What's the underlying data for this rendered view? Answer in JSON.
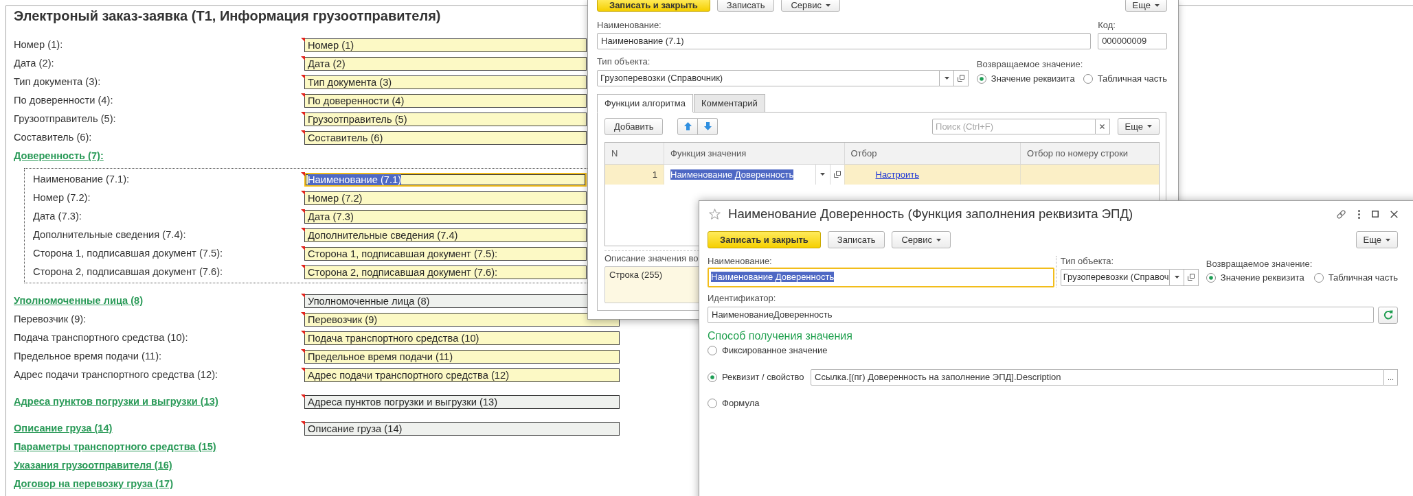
{
  "main_form": {
    "title": "Электроный заказ-заявка (Т1, Информация грузоотправителя)",
    "rows": [
      {
        "kind": "field",
        "label": "Номер (1):",
        "value": "Номер (1)"
      },
      {
        "kind": "field",
        "label": "Дата (2):",
        "value": "Дата (2)"
      },
      {
        "kind": "field",
        "label": "Тип документа (3):",
        "value": "Тип документа (3)"
      },
      {
        "kind": "field",
        "label": "По доверенности (4):",
        "value": "По доверенности (4)"
      },
      {
        "kind": "field",
        "label": "Грузоотправитель (5):",
        "value": "Грузоотправитель (5)"
      },
      {
        "kind": "field",
        "label": "Составитель (6):",
        "value": "Составитель (6)"
      },
      {
        "kind": "group",
        "label": "Доверенность (7):",
        "fields": [
          {
            "label": "Наименование (7.1):",
            "value": "Наименование (7.1)",
            "focused": true
          },
          {
            "label": "Номер (7.2):",
            "value": "Номер (7.2)",
            "focused": false
          },
          {
            "label": "Дата (7.3):",
            "value": "Дата (7.3)",
            "focused": false
          },
          {
            "label": "Дополнительные сведения (7.4):",
            "value": "Дополнительные сведения (7.4)",
            "focused": false
          },
          {
            "label": "Сторона 1, подписавшая документ (7.5):",
            "value": "Сторона 1, подписавшая документ (7.5):",
            "focused": false
          },
          {
            "label": "Сторона 2, подписавшая документ (7.6):",
            "value": "Сторона 2, подписавшая документ (7.6):",
            "focused": false
          }
        ]
      },
      {
        "kind": "link_field",
        "label": "Уполномоченные лица (8)",
        "value": "Уполномоченные лица (8)"
      },
      {
        "kind": "field",
        "label": "Перевозчик (9):",
        "value": "Перевозчик (9)"
      },
      {
        "kind": "field",
        "label": "Подача транспортного средства (10):",
        "value": "Подача транспортного средства (10)"
      },
      {
        "kind": "field",
        "label": "Предельное время подачи (11):",
        "value": "Предельное время подачи (11)"
      },
      {
        "kind": "field",
        "label": "Адрес подачи транспортного средства (12):",
        "value": "Адрес подачи транспортного средства (12)"
      },
      {
        "kind": "link_field",
        "label": "Адреса пунктов погрузки и выгрузки (13)",
        "value": "Адреса пунктов погрузки и выгрузки (13)"
      },
      {
        "kind": "link_field",
        "label": "Описание груза (14)",
        "value": "Описание груза (14)"
      },
      {
        "kind": "link",
        "label": "Параметры транспортного средства (15)"
      },
      {
        "kind": "link",
        "label": "Указания грузоотправителя (16)"
      },
      {
        "kind": "link",
        "label": "Договор на перевозку груза (17)"
      }
    ]
  },
  "back_dialog": {
    "buttons": [
      {
        "kind": "primary",
        "label": "Записать и закрыть"
      },
      {
        "kind": "plain",
        "label": "Записать"
      },
      {
        "kind": "menu",
        "label": "Сервис"
      }
    ],
    "more_button": "Еще",
    "name_field": {
      "label": "Наименование:",
      "value": "Наименование (7.1)"
    },
    "code_field": {
      "label": "Код:",
      "value": "000000009"
    },
    "object_type_field": {
      "label": "Тип объекта:",
      "value": "Грузоперевозки (Справочник)"
    },
    "return_value": {
      "label": "Возвращаемое значение:",
      "options": [
        {
          "label": "Значение реквизита",
          "selected": true
        },
        {
          "label": "Табличная часть",
          "selected": false
        }
      ]
    },
    "tabs": [
      {
        "label": "Функции алгоритма",
        "selected": true
      },
      {
        "label": "Комментарий",
        "selected": false
      }
    ],
    "toolbar": {
      "add_button": "Добавить",
      "search_placeholder": "Поиск (Ctrl+F)",
      "more_button": "Еще"
    },
    "table": {
      "columns": [
        "N",
        "Функция значения",
        "Отбор",
        "Отбор по номеру строки"
      ],
      "rows": [
        {
          "number": "1",
          "function": "Наименование Доверенность",
          "filter": "Настроить",
          "selected": true
        }
      ]
    },
    "description": {
      "label": "Описание значения во",
      "value": "Строка (255)"
    }
  },
  "front_dialog": {
    "title": "Наименование Доверенность (Функция заполнения реквизита ЭПД)",
    "buttons": [
      {
        "kind": "primary",
        "label": "Записать и закрыть"
      },
      {
        "kind": "plain",
        "label": "Записать"
      },
      {
        "kind": "menu",
        "label": "Сервис"
      }
    ],
    "more_button": "Еще",
    "name_field": {
      "label": "Наименование:",
      "value": "Наименование Доверенность",
      "focused": true
    },
    "object_type_field": {
      "label": "Тип объекта:",
      "value": "Грузоперевозки (Справоч"
    },
    "return_value": {
      "label": "Возвращаемое значение:",
      "options": [
        {
          "label": "Значение реквизита",
          "selected": true
        },
        {
          "label": "Табличная часть",
          "selected": false
        }
      ]
    },
    "identifier_field": {
      "label": "Идентификатор:",
      "value": "НаименованиеДоверенность"
    },
    "method_heading": "Способ получения значения",
    "methods": [
      {
        "kind": "plain",
        "label": "Фиксированное значение",
        "selected": false
      },
      {
        "kind": "with_field",
        "label": "Реквизит / свойство",
        "selected": true,
        "value": "Ссылка.[(пг) Доверенность на заполнение ЭПД].Description",
        "choice_button": "..."
      },
      {
        "kind": "plain",
        "label": "Формула",
        "selected": false
      }
    ]
  }
}
